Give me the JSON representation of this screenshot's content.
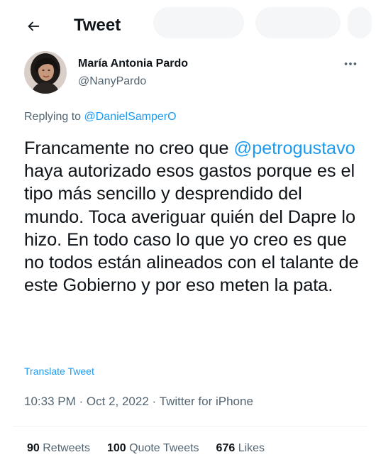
{
  "header": {
    "title": "Tweet",
    "back_icon": "arrow-left-icon"
  },
  "author": {
    "name": "María Antonia Pardo",
    "handle": "@NanyPardo",
    "more_icon": "more-horizontal-icon"
  },
  "replying": {
    "prefix": "Replying to",
    "handle": "@DanielSamperO"
  },
  "tweet": {
    "text_part1": "Francamente no creo que ",
    "mention": "@petrogustavo",
    "text_part2": " haya autorizado esos gastos porque es el tipo más sencillo y desprendido del mundo. Toca averiguar quién del Dapre lo hizo. En todo caso lo que yo creo es que no todos están alineados con el talante de este Gobierno y por eso meten la pata.",
    "translate_label": "Translate Tweet"
  },
  "meta": {
    "time": "10:33 PM",
    "separator": "·",
    "date": "Oct 2, 2022",
    "source": "Twitter for iPhone"
  },
  "stats": {
    "retweets_count": "90",
    "retweets_label": "Retweets",
    "quotes_count": "100",
    "quotes_label": "Quote Tweets",
    "likes_count": "676",
    "likes_label": "Likes"
  },
  "colors": {
    "link": "#1d9bf0",
    "text": "#0f1419",
    "secondary": "#536471",
    "divider": "#eff3f4"
  }
}
